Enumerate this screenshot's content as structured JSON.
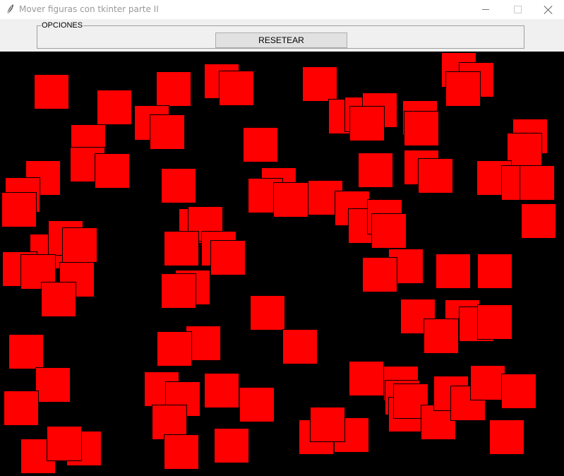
{
  "window": {
    "title": "Mover figuras con tkinter parte II",
    "icon": "feather-icon"
  },
  "options": {
    "group_label": "OPCIONES",
    "reset_label": "RESETEAR"
  },
  "canvas": {
    "background": "#000000",
    "shape_color": "#ff0000",
    "shape_outline": "#000000",
    "shape_type": "square"
  }
}
